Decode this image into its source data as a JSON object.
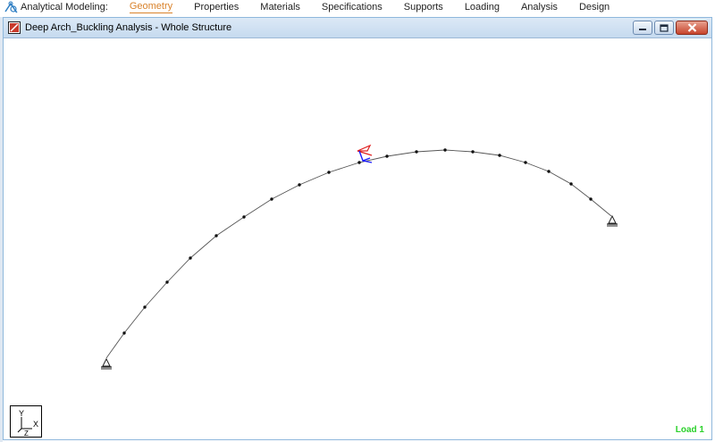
{
  "menubar": {
    "app_label": "Analytical Modeling:",
    "items": [
      {
        "label": "Geometry",
        "active": true
      },
      {
        "label": "Properties",
        "active": false
      },
      {
        "label": "Materials",
        "active": false
      },
      {
        "label": "Specifications",
        "active": false
      },
      {
        "label": "Supports",
        "active": false
      },
      {
        "label": "Loading",
        "active": false
      },
      {
        "label": "Analysis",
        "active": false
      },
      {
        "label": "Design",
        "active": false
      }
    ]
  },
  "window": {
    "title": "Deep Arch_Buckling Analysis - Whole Structure"
  },
  "axis_triad": {
    "y_label": "Y",
    "x_label": "X",
    "z_label": "Z"
  },
  "status": {
    "load_label": "Load 1",
    "load_color": "#2bd12b"
  },
  "colors": {
    "accent_active_menu": "#d9822b",
    "load_arrow_primary": "#e02020",
    "load_arrow_secondary": "#1a1aff",
    "structure_line": "#555555"
  }
}
